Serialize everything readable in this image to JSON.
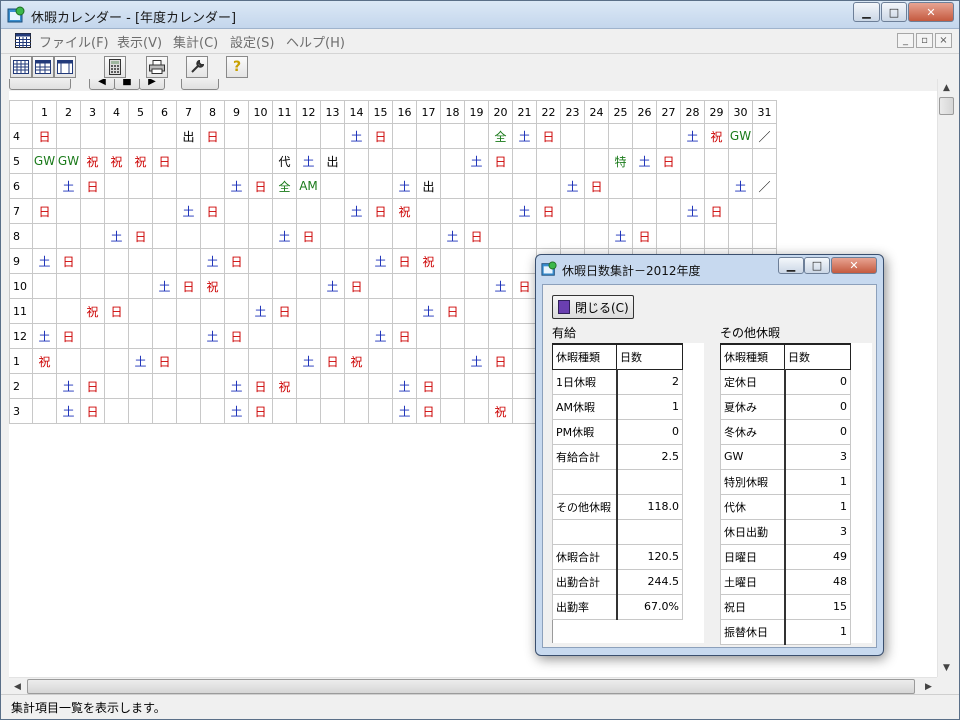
{
  "window": {
    "title": "休暇カレンダー - [年度カレンダー]",
    "min_label": "▁",
    "max_label": "□",
    "close_label": "✕"
  },
  "menu": {
    "items": [
      "ファイル(F)",
      "表示(V)",
      "集計(C)",
      "設定(S)",
      "ヘルプ(H)"
    ],
    "mdi_min": "_",
    "mdi_restore": "▫",
    "mdi_close": "×"
  },
  "toolbar": {
    "buttons": [
      "year-view",
      "month-view",
      "week-view",
      "calculator",
      "print",
      "settings",
      "help"
    ],
    "help_glyph": "?"
  },
  "calendar": {
    "days": [
      "1",
      "2",
      "3",
      "4",
      "5",
      "6",
      "7",
      "8",
      "9",
      "10",
      "11",
      "12",
      "13",
      "14",
      "15",
      "16",
      "17",
      "18",
      "19",
      "20",
      "21",
      "22",
      "23",
      "24",
      "25",
      "26",
      "27",
      "28",
      "29",
      "30",
      "31"
    ],
    "months": [
      "4",
      "5",
      "6",
      "7",
      "8",
      "9",
      "10",
      "11",
      "12",
      "1",
      "2",
      "3"
    ],
    "rows": [
      [
        "日",
        "",
        "",
        "",
        "",
        "",
        "出",
        "日",
        "",
        "",
        "",
        "",
        "",
        "土",
        "日",
        "",
        "",
        "",
        "",
        "全",
        "土",
        "日",
        "",
        "",
        "",
        "",
        "",
        "土",
        "祝",
        "GW",
        "／"
      ],
      [
        "GW",
        "GW",
        "祝",
        "祝",
        "祝",
        "日",
        "",
        "",
        "",
        "",
        "代",
        "土",
        "出",
        "",
        "",
        "",
        "",
        "",
        "土",
        "日",
        "",
        "",
        "",
        "",
        "特",
        "土",
        "日",
        "",
        "",
        "",
        ""
      ],
      [
        "",
        "土",
        "日",
        "",
        "",
        "",
        "",
        "",
        "土",
        "日",
        "全",
        "AM",
        "",
        "",
        "",
        "土",
        "出",
        "",
        "",
        "",
        "",
        "",
        "土",
        "日",
        "",
        "",
        "",
        "",
        "",
        "土",
        "／"
      ],
      [
        "日",
        "",
        "",
        "",
        "",
        "",
        "土",
        "日",
        "",
        "",
        "",
        "",
        "",
        "土",
        "日",
        "祝",
        "",
        "",
        "",
        "",
        "土",
        "日",
        "",
        "",
        "",
        "",
        "",
        "土",
        "日",
        "",
        ""
      ],
      [
        "",
        "",
        "",
        "土",
        "日",
        "",
        "",
        "",
        "",
        "",
        "土",
        "日",
        "",
        "",
        "",
        "",
        "",
        "土",
        "日",
        "",
        "",
        "",
        "",
        "",
        "土",
        "日",
        "",
        "",
        "",
        "",
        ""
      ],
      [
        "土",
        "日",
        "",
        "",
        "",
        "",
        "",
        "土",
        "日",
        "",
        "",
        "",
        "",
        "",
        "土",
        "日",
        "祝",
        "",
        "",
        "",
        "",
        "",
        "",
        "",
        "",
        "",
        "",
        "",
        "",
        "",
        ""
      ],
      [
        "",
        "",
        "",
        "",
        "",
        "土",
        "日",
        "祝",
        "",
        "",
        "",
        "",
        "土",
        "日",
        "",
        "",
        "",
        "",
        "",
        "土",
        "日",
        "",
        "",
        "",
        "",
        "",
        "",
        "",
        "",
        "",
        ""
      ],
      [
        "",
        "",
        "祝",
        "日",
        "",
        "",
        "",
        "",
        "",
        "土",
        "日",
        "",
        "",
        "",
        "",
        "",
        "土",
        "日",
        "",
        "",
        "",
        "",
        "",
        "",
        "",
        "",
        "",
        "",
        "",
        "",
        ""
      ],
      [
        "土",
        "日",
        "",
        "",
        "",
        "",
        "",
        "土",
        "日",
        "",
        "",
        "",
        "",
        "",
        "土",
        "日",
        "",
        "",
        "",
        "",
        "",
        "",
        "",
        "",
        "",
        "",
        "",
        "",
        "",
        "",
        ""
      ],
      [
        "祝",
        "",
        "",
        "",
        "土",
        "日",
        "",
        "",
        "",
        "",
        "",
        "土",
        "日",
        "祝",
        "",
        "",
        "",
        "",
        "土",
        "日",
        "",
        "",
        "",
        "",
        "",
        "",
        "",
        "",
        "",
        "",
        ""
      ],
      [
        "",
        "土",
        "日",
        "",
        "",
        "",
        "",
        "",
        "土",
        "日",
        "祝",
        "",
        "",
        "",
        "",
        "土",
        "日",
        "",
        "",
        "",
        "",
        "",
        "",
        "",
        "",
        "",
        "",
        "",
        "",
        "",
        ""
      ],
      [
        "",
        "土",
        "日",
        "",
        "",
        "",
        "",
        "",
        "土",
        "日",
        "",
        "",
        "",
        "",
        "",
        "土",
        "日",
        "",
        "",
        "祝",
        "",
        "",
        "",
        "",
        "",
        "",
        "",
        "",
        "",
        "",
        ""
      ]
    ]
  },
  "colors": {
    "日": "#cc0000",
    "祝": "#cc0000",
    "土": "#1a2fb8",
    "全": "#1a7a1a",
    "AM": "#1a7a1a",
    "GW": "#1a7a1a",
    "特": "#1a7a1a",
    "代": "#000000",
    "出": "#000000",
    "／": "#000000"
  },
  "status": {
    "text": "集計項目一覧を表示します。"
  },
  "dialog": {
    "title": "休暇日数集計－2012年度",
    "close_button": "閉じる(C)",
    "paid": {
      "label": "有給",
      "headers": [
        "休暇種類",
        "日数"
      ],
      "rows": [
        [
          "1日休暇",
          "2"
        ],
        [
          "AM休暇",
          "1"
        ],
        [
          "PM休暇",
          "0"
        ],
        [
          "有給合計",
          "2.5"
        ],
        [
          "",
          ""
        ],
        [
          "その他休暇",
          "118.0"
        ],
        [
          "",
          ""
        ],
        [
          "休暇合計",
          "120.5"
        ],
        [
          "出勤合計",
          "244.5"
        ],
        [
          "出勤率",
          "67.0%"
        ]
      ]
    },
    "other": {
      "label": "その他休暇",
      "headers": [
        "休暇種類",
        "日数"
      ],
      "rows": [
        [
          "定休日",
          "0"
        ],
        [
          "夏休み",
          "0"
        ],
        [
          "冬休み",
          "0"
        ],
        [
          "GW",
          "3"
        ],
        [
          "特別休暇",
          "1"
        ],
        [
          "代休",
          "1"
        ],
        [
          "休日出勤",
          "3"
        ],
        [
          "日曜日",
          "49"
        ],
        [
          "土曜日",
          "48"
        ],
        [
          "祝日",
          "15"
        ],
        [
          "振替休日",
          "1"
        ]
      ]
    }
  }
}
